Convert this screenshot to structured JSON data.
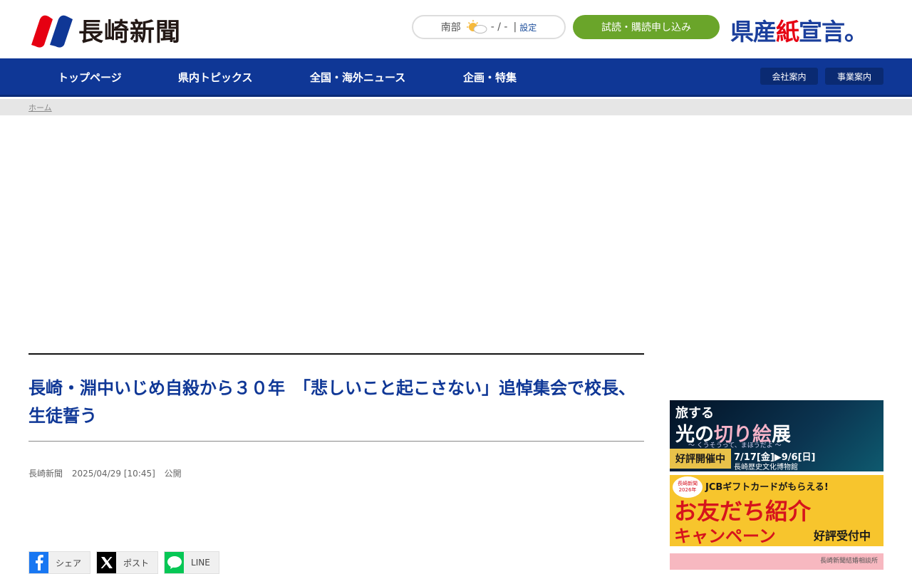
{
  "header": {
    "logo_text": "長崎新聞",
    "weather": {
      "region": "南部",
      "temperature": "- / -",
      "separator": "|",
      "setting_label": "設定",
      "icon": "partly-sunny-icon"
    },
    "subscribe_label": "試読・購読申し込み",
    "declaration": {
      "part1": "県産",
      "part2": "紙",
      "part3": "宣言。"
    }
  },
  "nav": {
    "items": [
      {
        "label": "トップページ"
      },
      {
        "label": "県内トピックス"
      },
      {
        "label": "全国・海外ニュース"
      },
      {
        "label": "企画・特集"
      }
    ],
    "buttons": [
      {
        "label": "会社案内"
      },
      {
        "label": "事業案内"
      }
    ]
  },
  "breadcrumb": {
    "home_label": "ホーム"
  },
  "article": {
    "headline": "長崎・淵中いじめ自殺から３０年　「悲しいこと起こさない」追悼集会で校長、生徒誓う",
    "source": "長崎新聞",
    "datetime": "2025/04/29 [10:45]",
    "status": "公開"
  },
  "share": [
    {
      "label": "シェア",
      "icon": "facebook-icon"
    },
    {
      "label": "ポスト",
      "icon": "x-icon"
    },
    {
      "label": "LINE",
      "icon": "line-icon"
    }
  ],
  "banners": {
    "b1": {
      "line1": "旅する",
      "line2a": "光の",
      "line2b": "切り絵",
      "line2c": "展",
      "sub": "〜 くうそうって、まほうだよ 〜",
      "status": "好評開催中",
      "dates": "7/17[金]▶9/6[日]",
      "venue": "長崎歴史文化博物館"
    },
    "b2": {
      "badge": "長崎新聞 2026年",
      "line1": "JCBギフトカードがもらえる!",
      "line2": "お友だち紹介",
      "line3": "キャンペーン",
      "status": "好評受付中"
    },
    "b3": {
      "label": "長崎新聞結婚相談所"
    }
  },
  "colors": {
    "nav_blue": "#0f3796",
    "subscribe_green": "#6aa52a",
    "headline_blue": "#0f3796",
    "declare_red": "#e60012"
  }
}
